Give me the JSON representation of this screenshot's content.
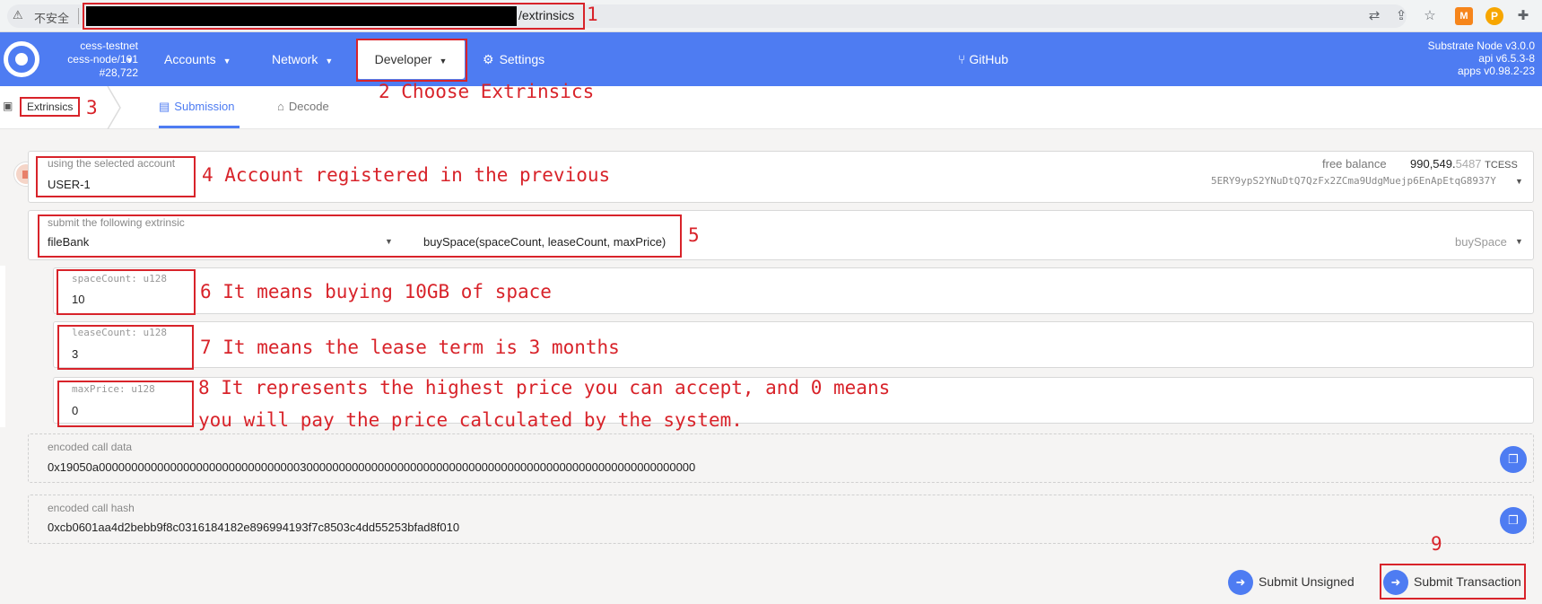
{
  "browser": {
    "insecure_label": "不安全",
    "url_path": "/extrinsics",
    "icons": [
      "translate-icon",
      "share-icon",
      "star-icon",
      "metamask-extension-icon",
      "polkadot-extension-icon",
      "extensions-puzzle-icon"
    ]
  },
  "chain": {
    "name": "cess-testnet",
    "node": "cess-node/101",
    "block": "#28,722"
  },
  "nav": {
    "accounts": "Accounts",
    "network": "Network",
    "developer": "Developer",
    "settings": "Settings",
    "github": "GitHub"
  },
  "node_info": {
    "name": "Substrate Node v3.0.0",
    "api": "api v6.5.3-8",
    "apps": "apps v0.98.2-23"
  },
  "subnav": {
    "section": "Extrinsics",
    "tab_submission": "Submission",
    "tab_decode": "Decode"
  },
  "account": {
    "label": "using the selected account",
    "value": "USER-1",
    "balance_label": "free balance",
    "balance_main": "990,549.",
    "balance_frac": "5487",
    "balance_unit": "TCESS",
    "address": "5ERY9ypS2YNuDtQ7QzFx2ZCma9UdgMuejp6EnApEtqG8937Y"
  },
  "extrinsic": {
    "label": "submit the following extrinsic",
    "pallet": "fileBank",
    "call_signature": "buySpace(spaceCount, leaseCount, maxPrice)",
    "method": "buySpace"
  },
  "params": [
    {
      "label": "spaceCount: u128",
      "value": "10"
    },
    {
      "label": "leaseCount: u128",
      "value": "3"
    },
    {
      "label": "maxPrice: u128",
      "value": "0"
    }
  ],
  "encoded": {
    "call_data_label": "encoded call data",
    "call_data": "0x19050a00000000000000000000000000000003000000000000000000000000000000000000000000000000000000000000",
    "call_hash_label": "encoded call hash",
    "call_hash": "0xcb0601aa4d2bebb9f8c0316184182e896994193f7c8503c4dd55253bfad8f010"
  },
  "actions": {
    "submit_unsigned": "Submit Unsigned",
    "submit_transaction": "Submit Transaction"
  },
  "annotations": {
    "a1": "1",
    "a2": "2 Choose Extrinsics",
    "a3": "3",
    "a4": "4 Account registered in the previous",
    "a5": "5",
    "a6": "6 It means buying 10GB of space",
    "a7": "7 It means the lease term is 3 months",
    "a8_line1": "8 It represents the highest price you can accept, and 0 means",
    "a8_line2": "you will pay the price calculated by the system.",
    "a9": "9"
  },
  "colors": {
    "accent": "#4e7cf2",
    "annotation_red": "#d8232a"
  }
}
